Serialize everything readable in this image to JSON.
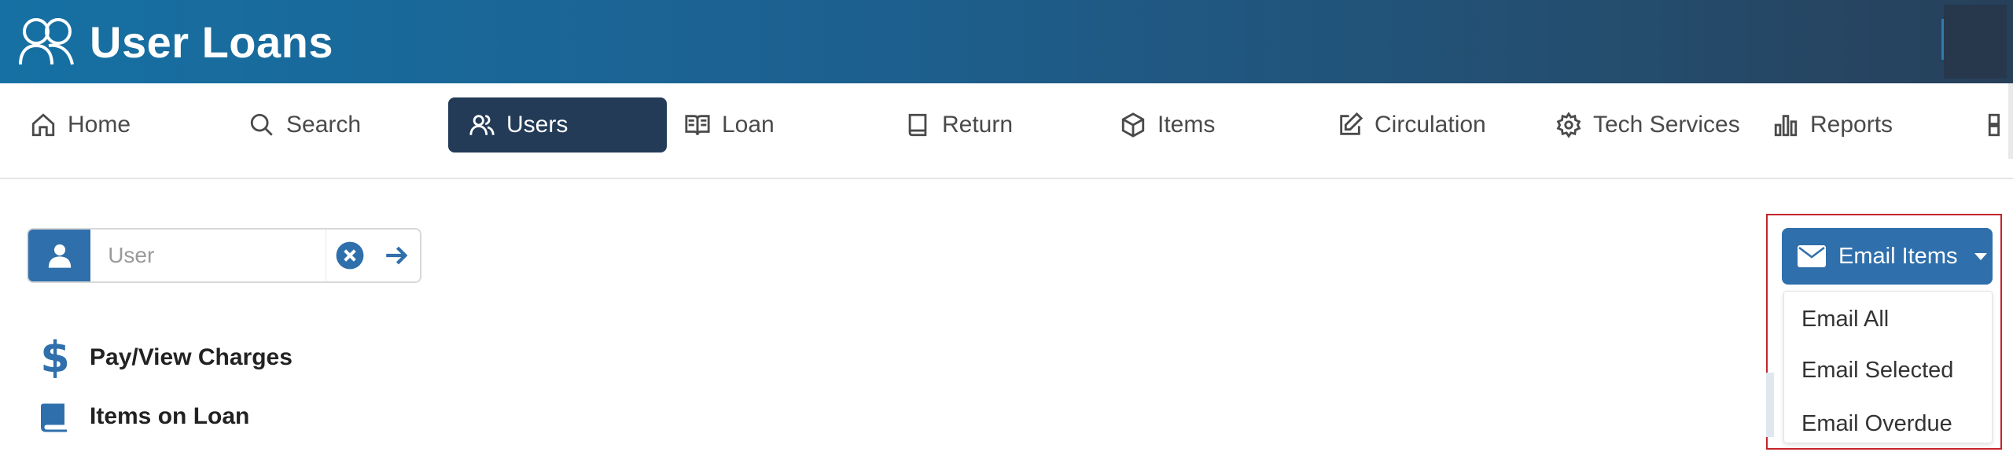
{
  "header": {
    "title": "User Loans",
    "icon": "users-icon"
  },
  "nav": {
    "items": [
      {
        "label": "Home",
        "icon": "home-icon"
      },
      {
        "label": "Search",
        "icon": "search-icon"
      },
      {
        "label": "Users",
        "icon": "users-icon",
        "active": true
      },
      {
        "label": "Loan",
        "icon": "book-open-icon"
      },
      {
        "label": "Return",
        "icon": "book-icon"
      },
      {
        "label": "Items",
        "icon": "box-icon"
      },
      {
        "label": "Circulation",
        "icon": "edit-icon"
      },
      {
        "label": "Tech Services",
        "icon": "gear-icon"
      },
      {
        "label": "Reports",
        "icon": "bar-chart-icon"
      }
    ]
  },
  "user_search": {
    "placeholder": "User",
    "value": ""
  },
  "side_links": {
    "pay_view_charges": "Pay/View Charges",
    "items_on_loan": "Items on Loan"
  },
  "email": {
    "button_label": "Email Items",
    "menu": [
      "Email All",
      "Email Selected",
      "Email Overdue"
    ]
  },
  "colors": {
    "header_start": "#1670a3",
    "header_end": "#27405a",
    "primary": "#2f6fab",
    "nav_active": "#243b57",
    "highlight_border": "#c4242a"
  }
}
